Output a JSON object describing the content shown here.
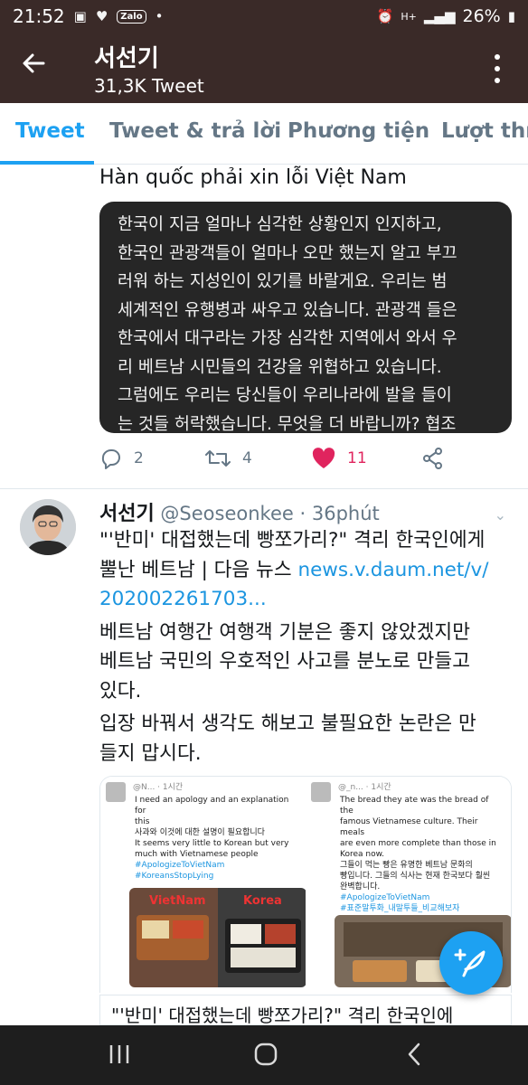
{
  "status_bar": {
    "time": "21:52",
    "battery": "26%",
    "network": "H+",
    "notification_app": "Zalo"
  },
  "header": {
    "title": "서선기",
    "subtitle": "31,3K Tweet"
  },
  "tabs": [
    {
      "label": "Tweet",
      "active": true
    },
    {
      "label": "Tweet & trả lời",
      "active": false
    },
    {
      "label": "Phương tiện",
      "active": false
    },
    {
      "label": "Lượt thích",
      "active": false
    }
  ],
  "tweet1": {
    "text": "Hàn quốc phải xin lỗi Việt Nam",
    "quote_lines": [
      "한국이 지금 얼마나 심각한 상황인지 인지하고,",
      "한국인 관광객들이 얼마나 오만 했는지 알고 부끄",
      "러워 하는 지성인이 있기를 바랄게요. 우리는 범",
      "세계적인 유행병과 싸우고 있습니다. 관광객 들은",
      "한국에서 대구라는 가장 심각한 지역에서 와서 우",
      "리 베트남 시민들의 건강을 위협하고 있습니다.",
      "그럼에도 우리는 당신들이 우리나라에 발을 들이",
      "는 것들 허락했습니다. 무엇을 더 바랍니까? 협조"
    ],
    "replies": "2",
    "retweets": "4",
    "likes": "11"
  },
  "tweet2": {
    "display_name": "서선기",
    "handle": "@Seoseonkee",
    "time": "36phút",
    "line1": "\"'반미' 대접했는데 빵쪼가리?\" 격리 한국인에게",
    "line2_text": "뿔난 베트남 | 다음 뉴스 ",
    "line2_link": "news.v.daum.net/v/",
    "line3_link": "202002261703...",
    "para2_l1": "베트남 여행간 여행객 기분은 좋지 않았겠지만",
    "para2_l2": "베트남 국민의 우호적인 사고를 분노로 만들고",
    "para2_l3": "있다.",
    "para3_l1": "입장 바꿔서 생각도 해보고 불필요한 논란은 만",
    "para3_l2": "들지 맙시다.",
    "link_card_title": "\"'반미' 대접했는데 빵쪼가리?\" 격리 한국인에"
  },
  "media_left": {
    "header": "@N...  · 1시간",
    "lines": [
      "I need an apology and an explanation for",
      "this",
      "사과와 이것에 대한 설명이 필요합니다",
      "It seems very little to Korean but very",
      "much with Vietnamese people"
    ],
    "tags": [
      "#ApologizeToVietNam",
      "#KoreansStopLying"
    ],
    "pic_label_left": "VietNam",
    "pic_label_right": "Korea"
  },
  "media_right": {
    "header": "@_n...  · 1시간",
    "lines": [
      "The bread they ate was the bread of the",
      "famous Vietnamese culture. Their meals",
      "are even more complete than those in",
      "Korea now.",
      "그들이 먹는 빵은 유명한 베트남 문화의",
      "빵입니다. 그들의 식사는 현재 한국보다 훨씬",
      "완벽합니다."
    ],
    "tags": [
      "#ApologizeToVietNam",
      "#표준말투화_내말투들_비교해보자"
    ]
  },
  "colors": {
    "accent": "#1da1f2",
    "like": "#e0245e",
    "header_bg": "#3a2a28"
  }
}
